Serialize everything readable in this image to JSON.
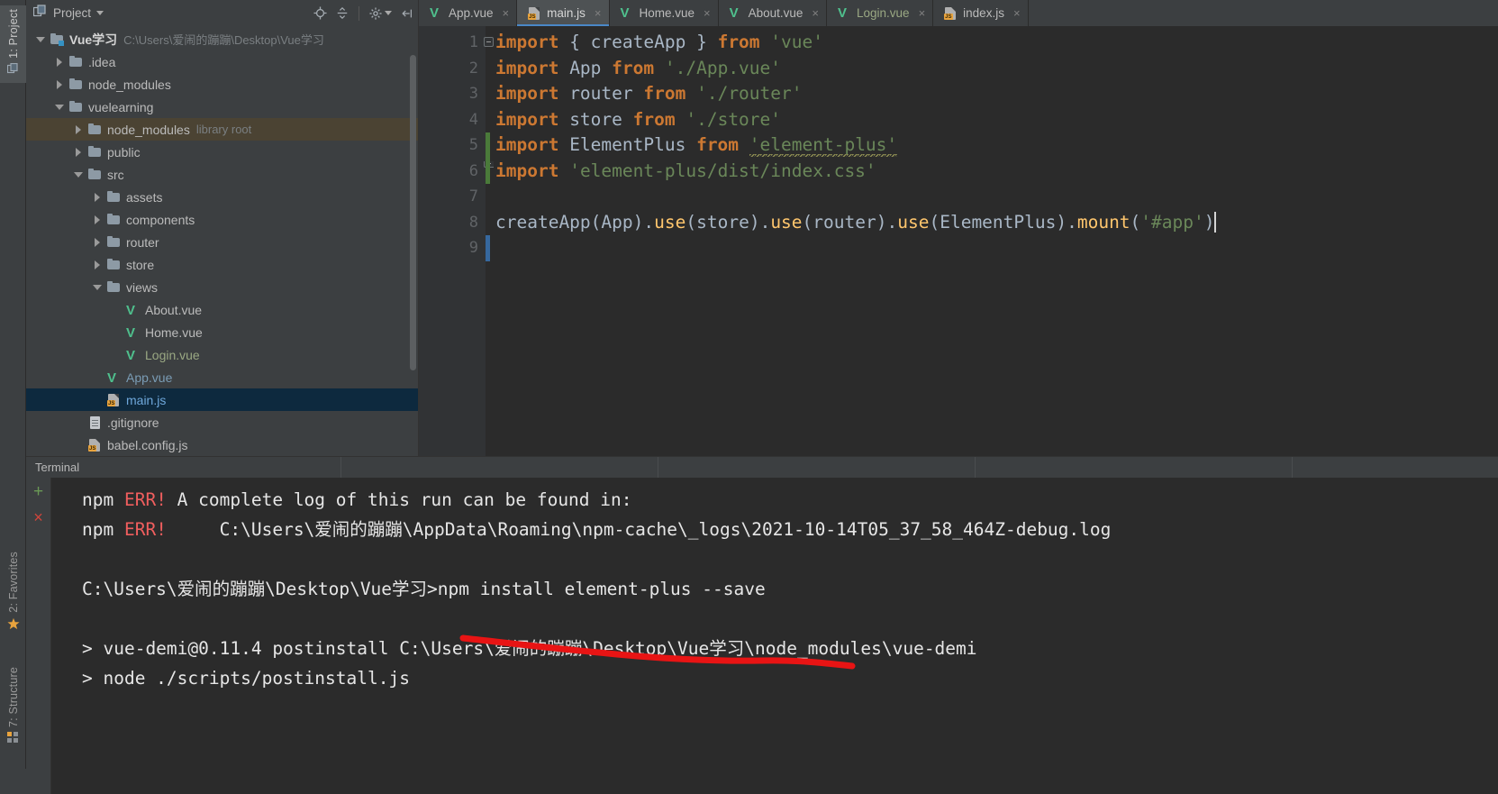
{
  "left_strip": {
    "tabs": [
      {
        "id": "project",
        "label": "1: Project",
        "icon": "project-icon"
      },
      {
        "id": "favorites",
        "label": "2: Favorites",
        "icon": "star-icon"
      },
      {
        "id": "structure",
        "label": "7: Structure",
        "icon": "structure-icon"
      }
    ]
  },
  "project_panel": {
    "title": "Project",
    "toolbar": {
      "locate": "locate-icon",
      "collapse_all": "collapse-all-icon",
      "settings": "gear-icon",
      "hide": "hide-icon"
    },
    "tree": [
      {
        "indent": 0,
        "twisty": "down",
        "icon": "folder-module",
        "label": "Vue学习",
        "sublabel": "C:\\Users\\爱闹的蹦蹦\\Desktop\\Vue学习",
        "style": "root"
      },
      {
        "indent": 1,
        "twisty": "right",
        "icon": "folder",
        "label": ".idea",
        "sublabel": "",
        "style": "default"
      },
      {
        "indent": 1,
        "twisty": "right",
        "icon": "folder",
        "label": "node_modules",
        "sublabel": "",
        "style": "default"
      },
      {
        "indent": 1,
        "twisty": "down",
        "icon": "folder",
        "label": "vuelearning",
        "sublabel": "",
        "style": "default"
      },
      {
        "indent": 2,
        "twisty": "right",
        "icon": "folder",
        "label": "node_modules",
        "sublabel": "library root",
        "style": "default",
        "highlight": true
      },
      {
        "indent": 2,
        "twisty": "right",
        "icon": "folder",
        "label": "public",
        "sublabel": "",
        "style": "default"
      },
      {
        "indent": 2,
        "twisty": "down",
        "icon": "folder",
        "label": "src",
        "sublabel": "",
        "style": "default"
      },
      {
        "indent": 3,
        "twisty": "right",
        "icon": "folder",
        "label": "assets",
        "sublabel": "",
        "style": "default"
      },
      {
        "indent": 3,
        "twisty": "right",
        "icon": "folder",
        "label": "components",
        "sublabel": "",
        "style": "default"
      },
      {
        "indent": 3,
        "twisty": "right",
        "icon": "folder",
        "label": "router",
        "sublabel": "",
        "style": "default"
      },
      {
        "indent": 3,
        "twisty": "right",
        "icon": "folder",
        "label": "store",
        "sublabel": "",
        "style": "default"
      },
      {
        "indent": 3,
        "twisty": "down",
        "icon": "folder",
        "label": "views",
        "sublabel": "",
        "style": "default"
      },
      {
        "indent": 4,
        "twisty": "none",
        "icon": "vue",
        "label": "About.vue",
        "sublabel": "",
        "style": "default"
      },
      {
        "indent": 4,
        "twisty": "none",
        "icon": "vue",
        "label": "Home.vue",
        "sublabel": "",
        "style": "default"
      },
      {
        "indent": 4,
        "twisty": "none",
        "icon": "vue",
        "label": "Login.vue",
        "sublabel": "",
        "style": "greenish"
      },
      {
        "indent": 3,
        "twisty": "none",
        "icon": "vue",
        "label": "App.vue",
        "sublabel": "",
        "style": "bluish"
      },
      {
        "indent": 3,
        "twisty": "none",
        "icon": "js",
        "label": "main.js",
        "sublabel": "",
        "style": "selected",
        "selected": true
      },
      {
        "indent": 2,
        "twisty": "none",
        "icon": "txt",
        "label": ".gitignore",
        "sublabel": "",
        "style": "default"
      },
      {
        "indent": 2,
        "twisty": "none",
        "icon": "js",
        "label": "babel.config.js",
        "sublabel": "",
        "style": "default"
      }
    ]
  },
  "editor": {
    "tabs": [
      {
        "label": "App.vue",
        "icon": "vue",
        "active": false,
        "dim": false,
        "close": "×"
      },
      {
        "label": "main.js",
        "icon": "js",
        "active": true,
        "dim": false,
        "close": "×"
      },
      {
        "label": "Home.vue",
        "icon": "vue",
        "active": false,
        "dim": false,
        "close": "×"
      },
      {
        "label": "About.vue",
        "icon": "vue",
        "active": false,
        "dim": false,
        "close": "×"
      },
      {
        "label": "Login.vue",
        "icon": "vue",
        "active": false,
        "dim": true,
        "close": "×"
      },
      {
        "label": "index.js",
        "icon": "js",
        "active": false,
        "dim": false,
        "close": "×"
      }
    ],
    "line_numbers": [
      "1",
      "2",
      "3",
      "4",
      "5",
      "6",
      "7",
      "8",
      "9"
    ],
    "lines": [
      {
        "n": 1,
        "tokens": [
          {
            "t": "import",
            "c": "kw"
          },
          {
            "t": " ",
            "c": "punc"
          },
          {
            "t": "{ createApp }",
            "c": "idn"
          },
          {
            "t": " ",
            "c": "punc"
          },
          {
            "t": "from",
            "c": "kw"
          },
          {
            "t": " ",
            "c": "punc"
          },
          {
            "t": "'vue'",
            "c": "str"
          }
        ]
      },
      {
        "n": 2,
        "tokens": [
          {
            "t": "import",
            "c": "kw"
          },
          {
            "t": " App ",
            "c": "idn"
          },
          {
            "t": "from",
            "c": "kw"
          },
          {
            "t": " ",
            "c": "punc"
          },
          {
            "t": "'./App.vue'",
            "c": "str"
          }
        ]
      },
      {
        "n": 3,
        "tokens": [
          {
            "t": "import",
            "c": "kw"
          },
          {
            "t": " router ",
            "c": "idn"
          },
          {
            "t": "from",
            "c": "kw"
          },
          {
            "t": " ",
            "c": "punc"
          },
          {
            "t": "'./router'",
            "c": "str"
          }
        ]
      },
      {
        "n": 4,
        "tokens": [
          {
            "t": "import",
            "c": "kw"
          },
          {
            "t": " store ",
            "c": "idn"
          },
          {
            "t": "from",
            "c": "kw"
          },
          {
            "t": " ",
            "c": "punc"
          },
          {
            "t": "'./store'",
            "c": "str"
          }
        ]
      },
      {
        "n": 5,
        "tokens": [
          {
            "t": "import",
            "c": "kw"
          },
          {
            "t": " ElementPlus ",
            "c": "idn"
          },
          {
            "t": "from",
            "c": "kw"
          },
          {
            "t": " ",
            "c": "punc"
          },
          {
            "t": "'element-plus'",
            "c": "str squig"
          }
        ]
      },
      {
        "n": 6,
        "tokens": [
          {
            "t": "import",
            "c": "kw"
          },
          {
            "t": " ",
            "c": "punc"
          },
          {
            "t": "'element-plus/dist/index.css'",
            "c": "str"
          }
        ]
      },
      {
        "n": 7,
        "tokens": []
      },
      {
        "n": 8,
        "tokens": [
          {
            "t": "createApp",
            "c": "idn"
          },
          {
            "t": "(",
            "c": "punc"
          },
          {
            "t": "App",
            "c": "idn"
          },
          {
            "t": ").",
            "c": "punc"
          },
          {
            "t": "use",
            "c": "mth"
          },
          {
            "t": "(",
            "c": "punc"
          },
          {
            "t": "store",
            "c": "idn"
          },
          {
            "t": ").",
            "c": "punc"
          },
          {
            "t": "use",
            "c": "mth"
          },
          {
            "t": "(",
            "c": "punc"
          },
          {
            "t": "router",
            "c": "idn"
          },
          {
            "t": ").",
            "c": "punc"
          },
          {
            "t": "use",
            "c": "mth"
          },
          {
            "t": "(",
            "c": "punc"
          },
          {
            "t": "ElementPlus",
            "c": "idn"
          },
          {
            "t": ").",
            "c": "punc"
          },
          {
            "t": "mount",
            "c": "mth"
          },
          {
            "t": "(",
            "c": "punc"
          },
          {
            "t": "'#app'",
            "c": "str"
          },
          {
            "t": ")",
            "c": "punc"
          }
        ]
      },
      {
        "n": 9,
        "tokens": []
      }
    ]
  },
  "terminal": {
    "tab_label": "Terminal",
    "buttons": {
      "new_session": "+",
      "kill_session": "×"
    },
    "lines": [
      {
        "id": "l1",
        "segments": [
          {
            "t": "npm ",
            "c": "wht"
          },
          {
            "t": "ERR!",
            "c": "err"
          },
          {
            "t": " A complete log of this run can be found in:",
            "c": "wht"
          }
        ]
      },
      {
        "id": "l2",
        "segments": [
          {
            "t": "npm ",
            "c": "wht"
          },
          {
            "t": "ERR!",
            "c": "err"
          },
          {
            "t": "     C:\\Users\\爱闹的蹦蹦\\AppData\\Roaming\\npm-cache\\_logs\\2021-10-14T05_37_58_464Z-debug.log",
            "c": "wht"
          }
        ]
      },
      {
        "id": "l3",
        "segments": [
          {
            "t": " ",
            "c": "wht"
          }
        ]
      },
      {
        "id": "l4",
        "segments": [
          {
            "t": "C:\\Users\\爱闹的蹦蹦\\Desktop\\Vue学习>npm install element-plus --save",
            "c": "wht"
          }
        ]
      },
      {
        "id": "l5",
        "segments": [
          {
            "t": " ",
            "c": "wht"
          }
        ]
      },
      {
        "id": "l6",
        "segments": [
          {
            "t": "> vue-demi@0.11.4 postinstall C:\\Users\\爱闹的蹦蹦\\Desktop\\Vue学习\\node_modules\\vue-demi",
            "c": "wht"
          }
        ]
      },
      {
        "id": "l7",
        "segments": [
          {
            "t": "> node ./scripts/postinstall.js",
            "c": "wht"
          }
        ]
      }
    ],
    "annotation": {
      "type": "red-underline",
      "color": "#e81414"
    }
  },
  "colors": {
    "accent_blue": "#4a88c7",
    "selection_blue": "#0d293e",
    "highlight_brown": "#4b4333",
    "keyword_orange": "#cc7832",
    "string_green": "#6a8759",
    "method_yellow": "#ffc66d",
    "error_red": "#f05e5e",
    "vue_green": "#4fc08d",
    "annotation_red": "#e81414",
    "panel_bg": "#3c3f41",
    "editor_bg": "#2b2b2b"
  }
}
